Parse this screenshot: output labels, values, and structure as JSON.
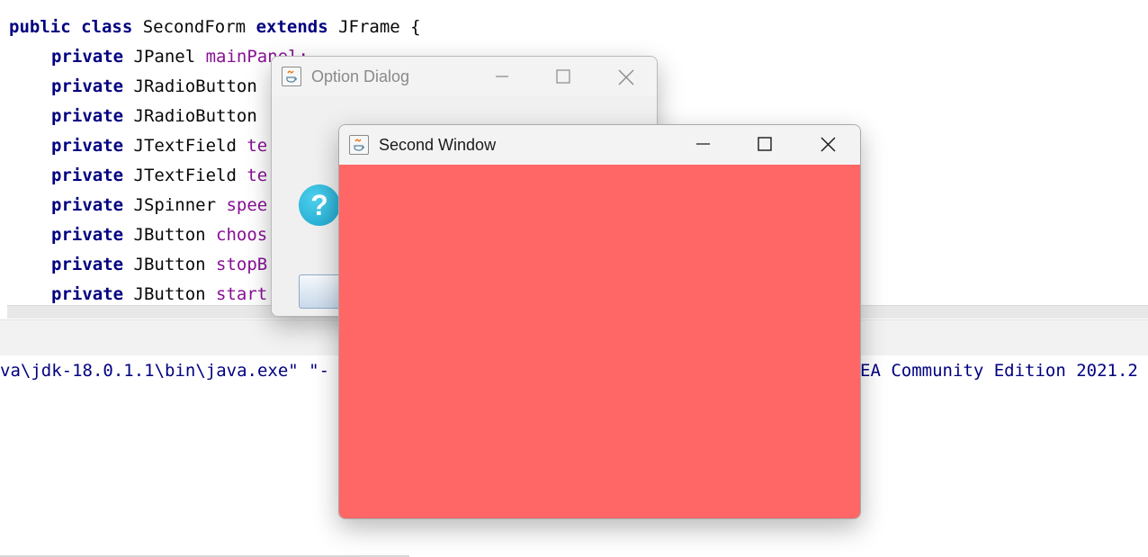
{
  "editor": {
    "lines": [
      {
        "keywords": "public class ",
        "type": "SecondForm ",
        "keyword2": "extends ",
        "rest": "JFrame {"
      },
      {
        "keyword": "private ",
        "type": "JPanel ",
        "field": "mainPanel;"
      },
      {
        "keyword": "private ",
        "type": "JRadioButton",
        "field": ""
      },
      {
        "keyword": "private ",
        "type": "JRadioButton",
        "field": ""
      },
      {
        "keyword": "private ",
        "type": "JTextField ",
        "field": "te"
      },
      {
        "keyword": "private ",
        "type": "JTextField ",
        "field": "te"
      },
      {
        "keyword": "private ",
        "type": "JSpinner ",
        "field": "spee"
      },
      {
        "keyword": "private ",
        "type": "JButton ",
        "field": "choos"
      },
      {
        "keyword": "private ",
        "type": "JButton ",
        "field": "stopB"
      },
      {
        "keyword": "private ",
        "type": "JButton ",
        "field": "start"
      }
    ]
  },
  "console": {
    "left_text": "va\\jdk-18.0.1.1\\bin\\java.exe\" \"-",
    "right_text": "EA Community Edition 2021.2"
  },
  "option_dialog": {
    "title": "Option Dialog",
    "icon": "question-icon",
    "icon_glyph": "?"
  },
  "second_window": {
    "title": "Second Window",
    "background_color": "#ff6666"
  },
  "colors": {
    "keyword": "#000080",
    "field": "#871094",
    "content_panel": "#ff6666"
  }
}
